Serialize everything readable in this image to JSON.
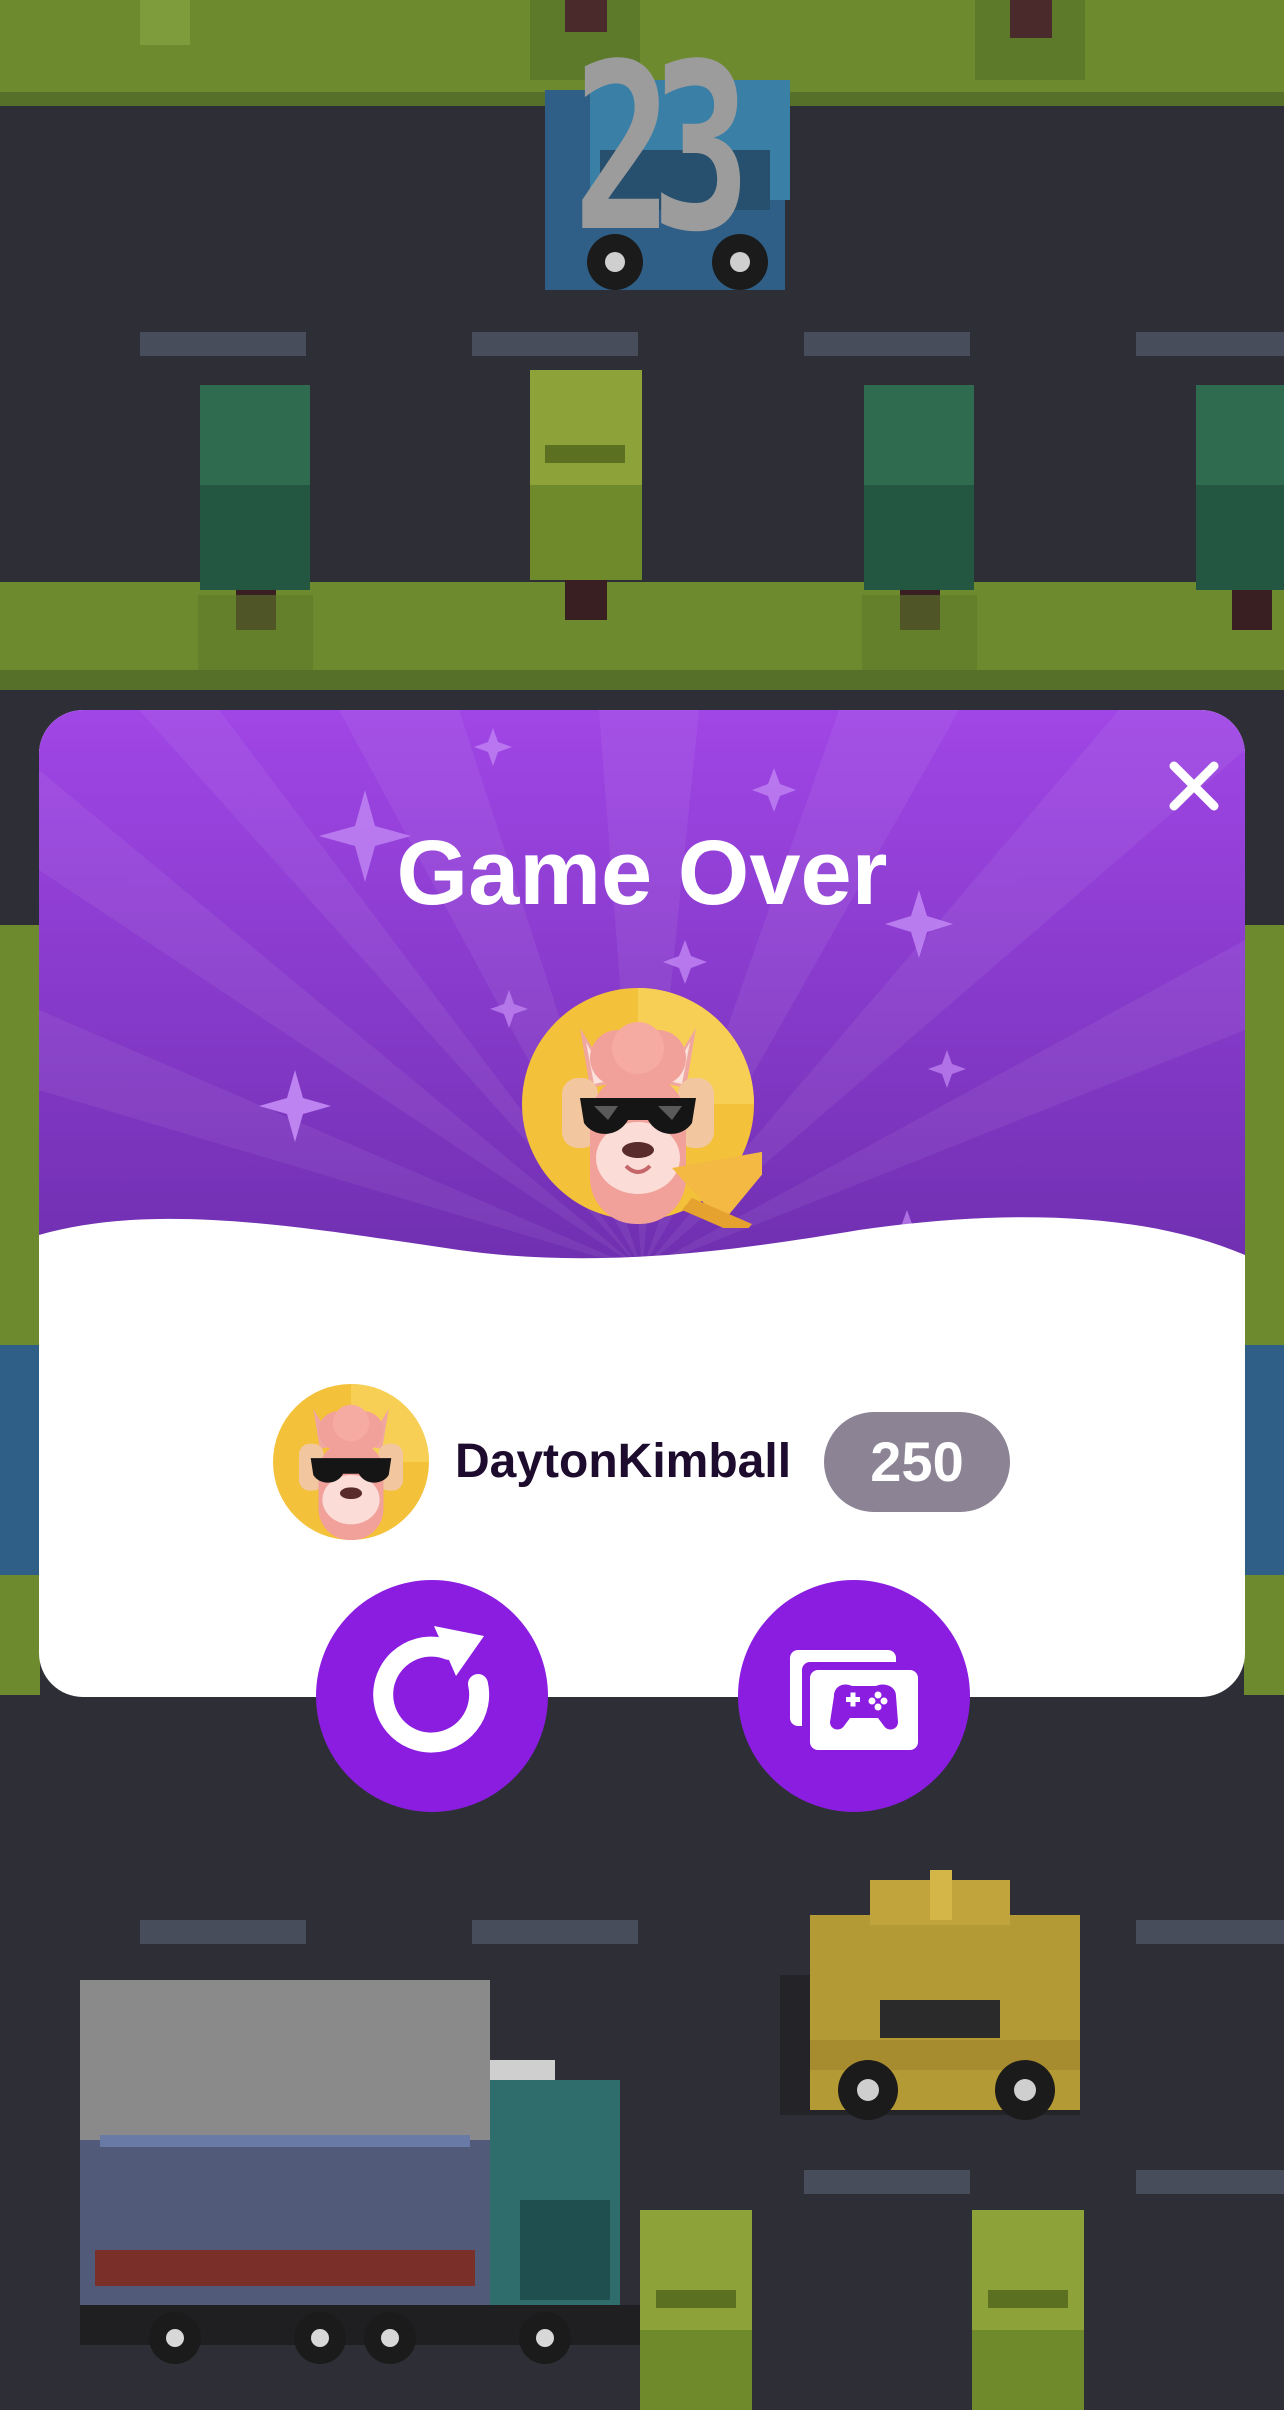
{
  "scene": {
    "score_counter": "23"
  },
  "modal": {
    "title": "Game Over",
    "close_icon": "close-icon",
    "player": {
      "name": "DaytonKimball",
      "score": "250",
      "avatar_icon": "llama-avatar-icon"
    },
    "actions": {
      "replay_icon": "replay-icon",
      "more_games_icon": "game-library-icon"
    }
  },
  "colors": {
    "header_purple_top": "#a046e6",
    "header_purple_bottom": "#6f2fb0",
    "action_button": "#8a1de0",
    "score_pill": "#8c8495",
    "name_text": "#1e0c2e",
    "scene_road": "#2e2f36",
    "scene_grass": "#6e8a2e"
  }
}
